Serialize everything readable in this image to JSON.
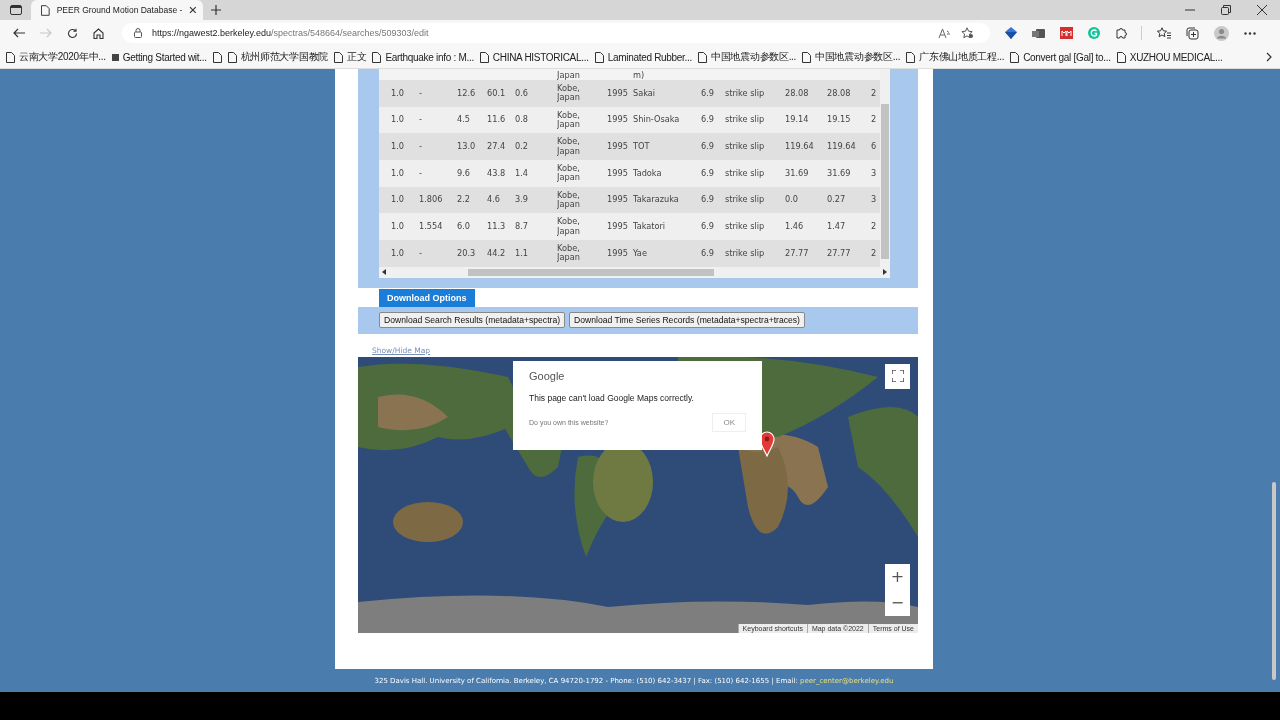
{
  "browser": {
    "tab_title": "PEER Ground Motion Database -",
    "url_host": "https://ngawest2.berkeley.edu",
    "url_path": "/spectras/548664/searches/509303/edit",
    "bookmarks": [
      {
        "kind": "page",
        "label": "云南大学2020年中..."
      },
      {
        "kind": "app",
        "label": "Getting Started wit..."
      },
      {
        "kind": "page"
      },
      {
        "kind": "page",
        "label": "杭州师范大学国教院"
      },
      {
        "kind": "page",
        "label": "正文"
      },
      {
        "kind": "page",
        "label": "Earthquake info : M..."
      },
      {
        "kind": "page",
        "label": "CHINA HISTORICAL..."
      },
      {
        "kind": "page",
        "label": "Laminated Rubber..."
      },
      {
        "kind": "page",
        "label": "中国地震动参数区..."
      },
      {
        "kind": "page",
        "label": "中国地震动参数区..."
      },
      {
        "kind": "page",
        "label": "广东佛山地质工程..."
      },
      {
        "kind": "page",
        "label": "Convert gal [Gal] to..."
      },
      {
        "kind": "page",
        "label": "XUZHOU MEDICAL..."
      }
    ]
  },
  "table": {
    "partial_row": {
      "column_6": "Japan",
      "column_8": "m)"
    },
    "rows": [
      [
        "1.0",
        "-",
        "12.6",
        "60.1",
        "0.6",
        "Kobe, Japan",
        "1995",
        "Sakai",
        "6.9",
        "strike slip",
        "28.08",
        "28.08",
        "2"
      ],
      [
        "1.0",
        "-",
        "4.5",
        "11.6",
        "0.8",
        "Kobe, Japan",
        "1995",
        "Shin-Osaka",
        "6.9",
        "strike slip",
        "19.14",
        "19.15",
        "2"
      ],
      [
        "1.0",
        "-",
        "13.0",
        "27.4",
        "0.2",
        "Kobe, Japan",
        "1995",
        "TOT",
        "6.9",
        "strike slip",
        "119.64",
        "119.64",
        "6"
      ],
      [
        "1.0",
        "-",
        "9.6",
        "43.8",
        "1.4",
        "Kobe, Japan",
        "1995",
        "Tadoka",
        "6.9",
        "strike slip",
        "31.69",
        "31.69",
        "3"
      ],
      [
        "1.0",
        "1.806",
        "2.2",
        "4.6",
        "3.9",
        "Kobe, Japan",
        "1995",
        "Takarazuka",
        "6.9",
        "strike slip",
        "0.0",
        "0.27",
        "3"
      ],
      [
        "1.0",
        "1.554",
        "6.0",
        "11.3",
        "8.7",
        "Kobe, Japan",
        "1995",
        "Takatori",
        "6.9",
        "strike slip",
        "1.46",
        "1.47",
        "2"
      ],
      [
        "1.0",
        "-",
        "20.3",
        "44.2",
        "1.1",
        "Kobe, Japan",
        "1995",
        "Yae",
        "6.9",
        "strike slip",
        "27.77",
        "27.77",
        "2"
      ]
    ]
  },
  "download_options": {
    "title": "Download Options",
    "buttons": [
      "Download Search Results (metadata+spectra)",
      "Download Time Series Records (metadata+spectra+traces)"
    ]
  },
  "map_link": "Show/Hide Map",
  "map": {
    "dialog": {
      "brand": "Google",
      "message": "This page can't load Google Maps correctly.",
      "question": "Do you own this website?",
      "button": "OK"
    },
    "zoom_in": "+",
    "zoom_out": "−",
    "attribution": [
      "Keyboard shortcuts",
      "Map data ©2022",
      "Terms of Use"
    ]
  },
  "footer": {
    "text": "325 Davis Hall. University of California. Berkeley, CA 94720-1792 - Phone: (510) 642-3437 | Fax: (510) 642-1655 | Email: ",
    "email": "peer_center@berkeley.edu"
  }
}
